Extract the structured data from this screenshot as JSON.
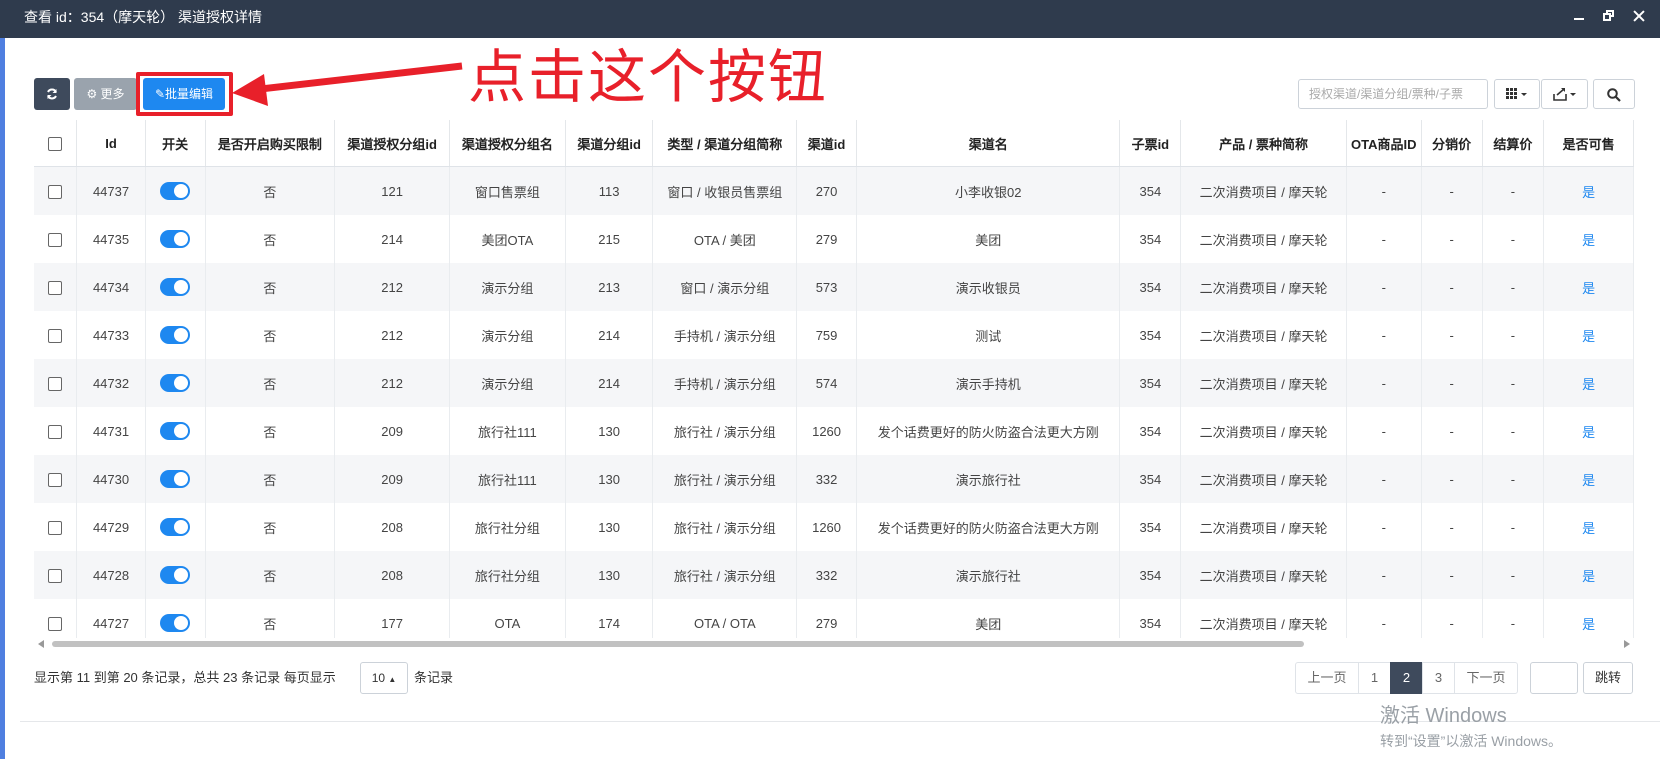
{
  "window": {
    "title": "查看 id：354（摩天轮） 渠道授权详情"
  },
  "toolbar": {
    "refresh_icon": "refresh-icon",
    "more_label": "更多",
    "more_icon": "gear-icon",
    "batch_edit_label": "批量编辑",
    "batch_edit_icon": "pencil-icon"
  },
  "annotation": {
    "text": "点击这个按钮",
    "color": "#e8202a"
  },
  "search": {
    "placeholder": "授权渠道/渠道分组/票种/子票"
  },
  "colors": {
    "accent": "#1e88f0",
    "dark": "#3e4a5c",
    "titlebar": "#2f3b4d"
  },
  "table": {
    "headers": [
      "Id",
      "开关",
      "是否开启购买限制",
      "渠道授权分组id",
      "渠道授权分组名",
      "渠道分组id",
      "类型 / 渠道分组简称",
      "渠道id",
      "渠道名",
      "子票id",
      "产品 / 票种简称",
      "OTA商品ID",
      "分销价",
      "结算价",
      "是否可售"
    ],
    "rows": [
      [
        "44737",
        "on",
        "否",
        "121",
        "窗口售票组",
        "113",
        "窗口 / 收银员售票组",
        "270",
        "小李收银02",
        "354",
        "二次消费项目 / 摩天轮",
        "-",
        "-",
        "-",
        "是"
      ],
      [
        "44735",
        "on",
        "否",
        "214",
        "美团OTA",
        "215",
        "OTA / 美团",
        "279",
        "美团",
        "354",
        "二次消费项目 / 摩天轮",
        "-",
        "-",
        "-",
        "是"
      ],
      [
        "44734",
        "on",
        "否",
        "212",
        "演示分组",
        "213",
        "窗口 / 演示分组",
        "573",
        "演示收银员",
        "354",
        "二次消费项目 / 摩天轮",
        "-",
        "-",
        "-",
        "是"
      ],
      [
        "44733",
        "on",
        "否",
        "212",
        "演示分组",
        "214",
        "手持机 / 演示分组",
        "759",
        "测试",
        "354",
        "二次消费项目 / 摩天轮",
        "-",
        "-",
        "-",
        "是"
      ],
      [
        "44732",
        "on",
        "否",
        "212",
        "演示分组",
        "214",
        "手持机 / 演示分组",
        "574",
        "演示手持机",
        "354",
        "二次消费项目 / 摩天轮",
        "-",
        "-",
        "-",
        "是"
      ],
      [
        "44731",
        "on",
        "否",
        "209",
        "旅行社111",
        "130",
        "旅行社 / 演示分组",
        "1260",
        "发个话费更好的防火防盗合法更大方刚",
        "354",
        "二次消费项目 / 摩天轮",
        "-",
        "-",
        "-",
        "是"
      ],
      [
        "44730",
        "on",
        "否",
        "209",
        "旅行社111",
        "130",
        "旅行社 / 演示分组",
        "332",
        "演示旅行社",
        "354",
        "二次消费项目 / 摩天轮",
        "-",
        "-",
        "-",
        "是"
      ],
      [
        "44729",
        "on",
        "否",
        "208",
        "旅行社分组",
        "130",
        "旅行社 / 演示分组",
        "1260",
        "发个话费更好的防火防盗合法更大方刚",
        "354",
        "二次消费项目 / 摩天轮",
        "-",
        "-",
        "-",
        "是"
      ],
      [
        "44728",
        "on",
        "否",
        "208",
        "旅行社分组",
        "130",
        "旅行社 / 演示分组",
        "332",
        "演示旅行社",
        "354",
        "二次消费项目 / 摩天轮",
        "-",
        "-",
        "-",
        "是"
      ],
      [
        "44727",
        "on",
        "否",
        "177",
        "OTA",
        "174",
        "OTA / OTA",
        "279",
        "美团",
        "354",
        "二次消费项目 / 摩天轮",
        "-",
        "-",
        "-",
        "是"
      ]
    ]
  },
  "pagination": {
    "info_prefix": "显示第 11 到第 20 条记录，总共 23 条记录 每页显示",
    "page_size": "10",
    "info_suffix": "条记录",
    "prev": "上一页",
    "pages": [
      "1",
      "2",
      "3"
    ],
    "current": "2",
    "next": "下一页",
    "jump": "跳转"
  },
  "watermark": {
    "line1": "激活 Windows",
    "line2": "转到“设置”以激活 Windows。"
  }
}
